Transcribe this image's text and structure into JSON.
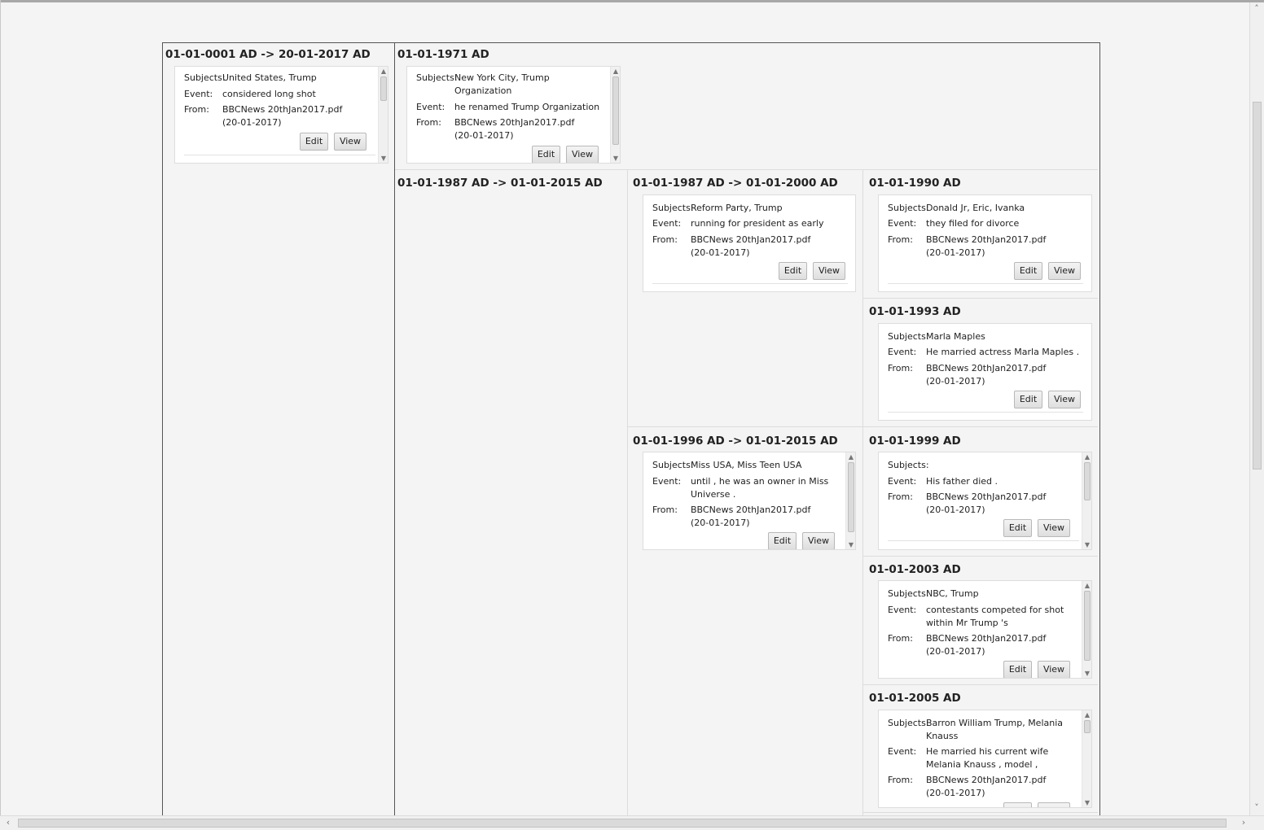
{
  "labels": {
    "subjects": "Subjects:",
    "event": "Event:",
    "from": "From:",
    "edit": "Edit",
    "view": "View"
  },
  "periods": {
    "p1": "01-01-0001 AD -> 20-01-2017 AD",
    "p2": "01-01-1971 AD",
    "p3": "01-01-1987 AD -> 01-01-2015 AD",
    "p4": "01-01-1987 AD -> 01-01-2000 AD",
    "p5": "01-01-1990 AD",
    "p6": "01-01-1993 AD",
    "p7": "01-01-1996 AD -> 01-01-2015 AD",
    "p8": "01-01-1999 AD",
    "p9": "01-01-2003 AD",
    "p10": "01-01-2005 AD"
  },
  "events": {
    "e1": {
      "subjects": "United States, Trump",
      "event": "considered long shot",
      "from": "BBCNews 20thJan2017.pdf\n(20-01-2017)"
    },
    "e2": {
      "subjects": "New York City, Trump\nOrganization",
      "event": "he renamed Trump Organization",
      "from": "BBCNews 20thJan2017.pdf\n(20-01-2017)"
    },
    "e3": {
      "subjects": "Reform Party, Trump",
      "event": "running for president as early",
      "from": "BBCNews 20thJan2017.pdf\n(20-01-2017)"
    },
    "e4": {
      "subjects": "Donald Jr, Eric, Ivanka",
      "event": "they filed for divorce",
      "from": "BBCNews 20thJan2017.pdf\n(20-01-2017)"
    },
    "e5": {
      "subjects": "Marla Maples",
      "event": "He married actress Marla Maples .",
      "from": "BBCNews 20thJan2017.pdf\n(20-01-2017)"
    },
    "e6": {
      "subjects": "Miss USA, Miss Teen USA",
      "event": "until , he was an owner in Miss\nUniverse .",
      "from": "BBCNews 20thJan2017.pdf\n(20-01-2017)"
    },
    "e7": {
      "subjects": "",
      "event": "His father died .",
      "from": "BBCNews 20thJan2017.pdf\n(20-01-2017)"
    },
    "e8": {
      "subjects": "NBC, Trump",
      "event": "contestants competed for shot\nwithin Mr Trump 's",
      "from": "BBCNews 20thJan2017.pdf\n(20-01-2017)"
    },
    "e9": {
      "subjects": "Barron William Trump, Melania\nKnauss",
      "event": "He married his current wife\nMelania Knauss , model ,",
      "from": "BBCNews 20thJan2017.pdf\n(20-01-2017)"
    }
  },
  "icons": {
    "up": "scroll-up-arrow-icon",
    "down": "scroll-down-arrow-icon",
    "left": "scroll-left-arrow-icon",
    "right": "scroll-right-arrow-icon"
  }
}
